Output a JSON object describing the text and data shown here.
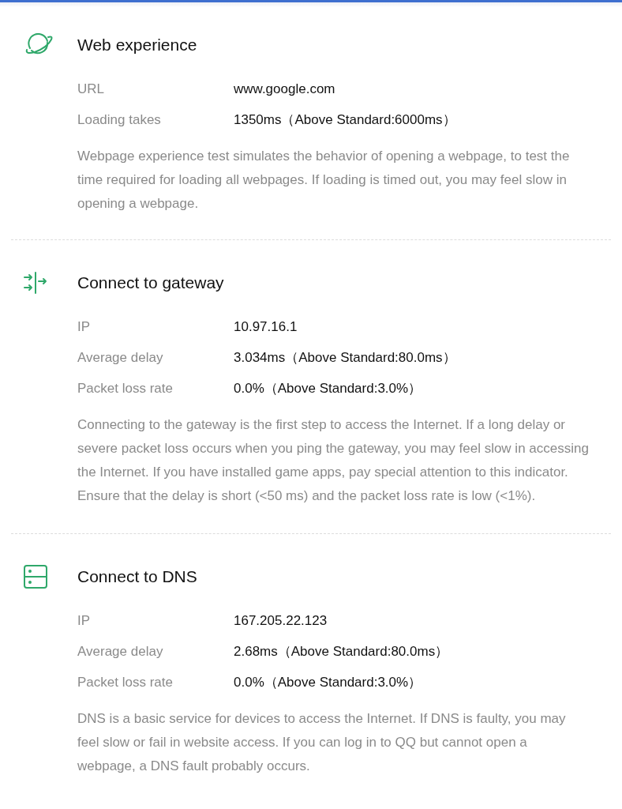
{
  "sections": [
    {
      "kind": "planet",
      "title": "Web experience",
      "rows": [
        {
          "label": "URL",
          "value": "www.google.com"
        },
        {
          "label": "Loading takes",
          "value": "1350ms（Above Standard:6000ms）"
        }
      ],
      "description": "Webpage experience test simulates the behavior of opening a webpage, to test the time required for loading all webpages. If loading is timed out, you may feel slow in opening a webpage."
    },
    {
      "kind": "gateway",
      "title": "Connect to gateway",
      "rows": [
        {
          "label": "IP",
          "value": "10.97.16.1"
        },
        {
          "label": "Average delay",
          "value": "3.034ms（Above Standard:80.0ms）"
        },
        {
          "label": "Packet loss rate",
          "value": "0.0%（Above Standard:3.0%）"
        }
      ],
      "description": "Connecting to the gateway is the first step to access the Internet. If a long delay or severe packet loss occurs when you ping the gateway, you may feel slow in accessing the Internet. If you have installed game apps, pay special attention to this indicator. Ensure that the delay is short (<50 ms) and the packet loss rate is low (<1%)."
    },
    {
      "kind": "server",
      "title": "Connect to DNS",
      "rows": [
        {
          "label": "IP",
          "value": "167.205.22.123"
        },
        {
          "label": "Average delay",
          "value": "2.68ms（Above Standard:80.0ms）"
        },
        {
          "label": "Packet loss rate",
          "value": "0.0%（Above Standard:3.0%）"
        }
      ],
      "description": "DNS is a basic service for devices to access the Internet. If DNS is faulty, you may feel slow or fail in website access. If you can log in to QQ but cannot open a webpage, a DNS fault probably occurs."
    }
  ]
}
